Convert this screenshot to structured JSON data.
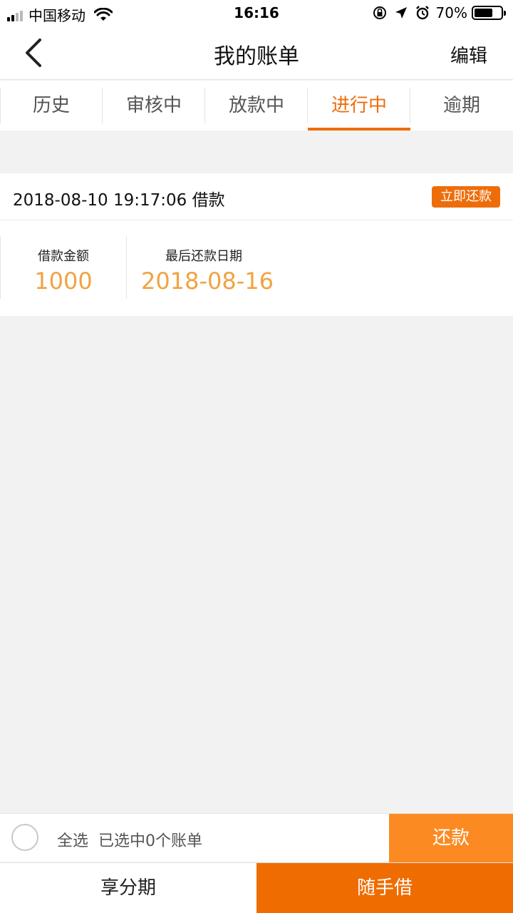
{
  "status_bar": {
    "carrier": "中国移动",
    "time": "16:16",
    "battery_percent": "70%",
    "battery_level": 0.7,
    "icons": [
      "signal-icon",
      "wifi-icon",
      "orientation-lock-icon",
      "location-icon",
      "alarm-icon",
      "battery-icon"
    ]
  },
  "nav": {
    "title": "我的账单",
    "edit_label": "编辑",
    "back_icon": "chevron-left-icon"
  },
  "tabs": [
    {
      "label": "历史",
      "active": false
    },
    {
      "label": "审核中",
      "active": false
    },
    {
      "label": "放款中",
      "active": false
    },
    {
      "label": "进行中",
      "active": true
    },
    {
      "label": "逾期",
      "active": false
    }
  ],
  "bill": {
    "date_line": "2018-08-10 19:17:06 借款",
    "repay_now_label": "立即还款",
    "amount_label": "借款金额",
    "amount_value": "1000",
    "due_label": "最后还款日期",
    "due_value": "2018-08-16"
  },
  "select_bar": {
    "select_all_label": "全选",
    "selected_count_text": "已选中0个账单",
    "repay_label": "还款"
  },
  "bottom_bar": {
    "left_label": "享分期",
    "right_label": "随手借"
  },
  "colors": {
    "accent": "#ee6d0b",
    "amount_text": "#f0a340",
    "repay_button": "#fb8a23",
    "bottom_right": "#ef6c00",
    "background": "#f2f2f2"
  }
}
